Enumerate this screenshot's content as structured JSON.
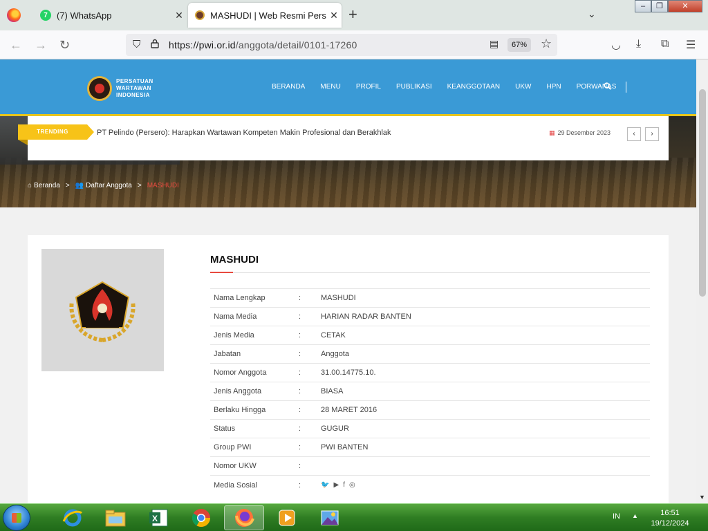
{
  "browser": {
    "tabs": [
      {
        "label": "(7) WhatsApp",
        "badge": "7"
      },
      {
        "label": "MASHUDI | Web Resmi Persatuan Wartawan Indonesia"
      }
    ],
    "url_host": "https://pwi.or.id",
    "url_path": "/anggota/detail/0101-17260",
    "zoom": "67%"
  },
  "site": {
    "logo_lines": [
      "PERSATUAN",
      "WARTAWAN",
      "INDONESIA"
    ],
    "nav": [
      "BERANDA",
      "MENU",
      "PROFIL",
      "PUBLIKASI",
      "KEANGGOTAAN",
      "UKW",
      "HPN",
      "PORWANAS"
    ],
    "trending": {
      "badge": "TRENDING",
      "headline": "PT Pelindo (Persero): Harapkan Wartawan Kompeten Makin Profesional dan Berakhlak",
      "date": "29 Desember 2023"
    },
    "breadcrumb": {
      "home": "Beranda",
      "list": "Daftar Anggota",
      "current": "MASHUDI"
    }
  },
  "member": {
    "name": "MASHUDI",
    "fields": [
      {
        "label": "Nama Lengkap",
        "value": "MASHUDI"
      },
      {
        "label": "Nama Media",
        "value": "HARIAN RADAR BANTEN"
      },
      {
        "label": "Jenis Media",
        "value": "CETAK"
      },
      {
        "label": "Jabatan",
        "value": "Anggota"
      },
      {
        "label": "Nomor Anggota",
        "value": "31.00.14775.10."
      },
      {
        "label": "Jenis Anggota",
        "value": "BIASA"
      },
      {
        "label": "Berlaku Hingga",
        "value": "28 MARET 2016"
      },
      {
        "label": "Status",
        "value": "GUGUR"
      },
      {
        "label": "Group PWI",
        "value": "PWI BANTEN"
      },
      {
        "label": "Nomor UKW",
        "value": ""
      },
      {
        "label": "Media Sosial",
        "value": ""
      }
    ],
    "colon": ":",
    "social_icons": [
      "twitter-icon",
      "youtube-icon",
      "facebook-icon",
      "instagram-icon"
    ]
  },
  "taskbar": {
    "lang": "IN",
    "time": "16:51",
    "date": "19/12/2024"
  },
  "colors": {
    "header_blue": "#3a9ad6",
    "accent_yellow": "#f7c318",
    "accent_red": "#e84a3f"
  }
}
